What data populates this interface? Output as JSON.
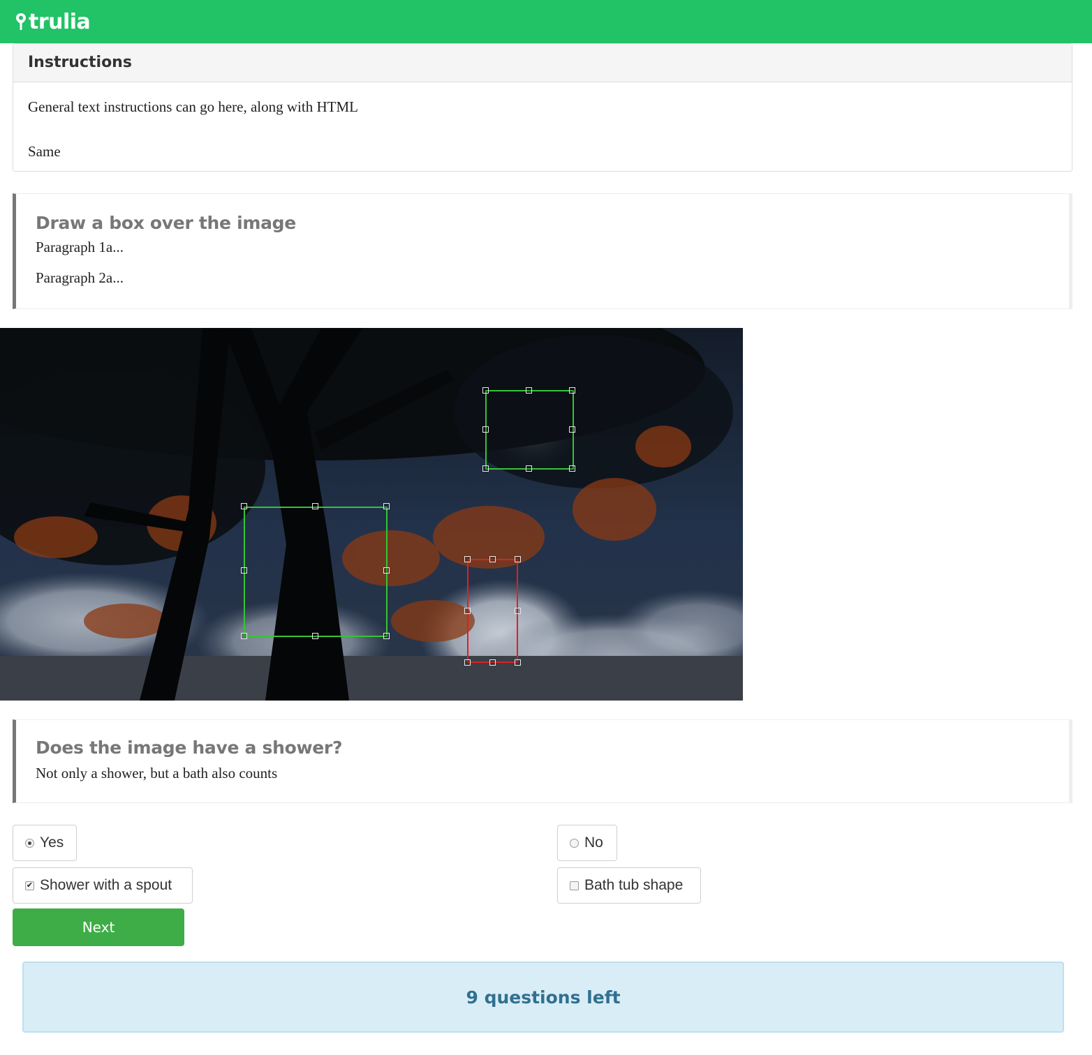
{
  "header": {
    "brand": "trulia",
    "brand_color": "#22c267",
    "logo_icon": "map-pin-icon"
  },
  "instructions": {
    "title": "Instructions",
    "line1": "General text instructions can go here, along with HTML",
    "line2": "Same"
  },
  "draw_task": {
    "title": "Draw a box over the image",
    "paragraphs": [
      "Paragraph 1a...",
      "Paragraph 2a..."
    ],
    "boxes": [
      {
        "color": "green"
      },
      {
        "color": "green"
      },
      {
        "color": "red"
      }
    ]
  },
  "question": {
    "title": "Does the image have a shower?",
    "subtitle": "Not only a shower, but a bath also counts"
  },
  "options": {
    "yes": {
      "label": "Yes",
      "selected": true
    },
    "no": {
      "label": "No",
      "selected": false
    },
    "shower_spout": {
      "label": "Shower with a spout",
      "checked": true
    },
    "bath_tub": {
      "label": "Bath tub shape",
      "checked": false
    }
  },
  "next_button": {
    "label": "Next"
  },
  "status": {
    "text": "9 questions left"
  }
}
